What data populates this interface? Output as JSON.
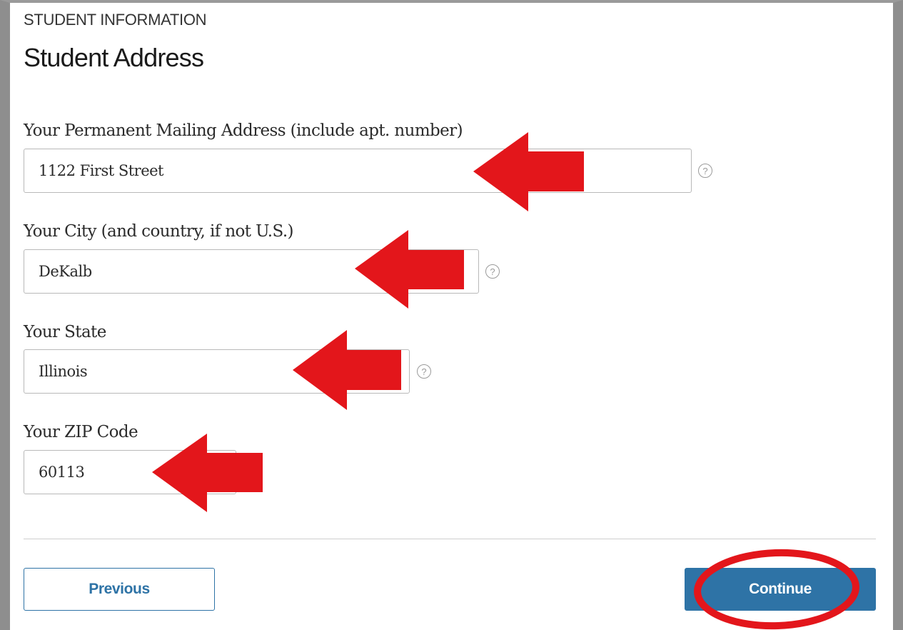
{
  "section_label": "STUDENT INFORMATION",
  "page_title": "Student Address",
  "fields": [
    {
      "label": "Your Permanent Mailing Address (include apt. number)",
      "value": "1122 First Street",
      "has_help": true
    },
    {
      "label": "Your City (and country, if not U.S.)",
      "value": "DeKalb",
      "has_help": true
    },
    {
      "label": "Your State",
      "value": "Illinois",
      "has_help": true
    },
    {
      "label": "Your ZIP Code",
      "value": "60113",
      "has_help": false
    }
  ],
  "help_icon_glyph": "?",
  "buttons": {
    "previous": "Previous",
    "continue": "Continue"
  },
  "colors": {
    "primary": "#2e73a6",
    "annotation": "#e3161b"
  }
}
